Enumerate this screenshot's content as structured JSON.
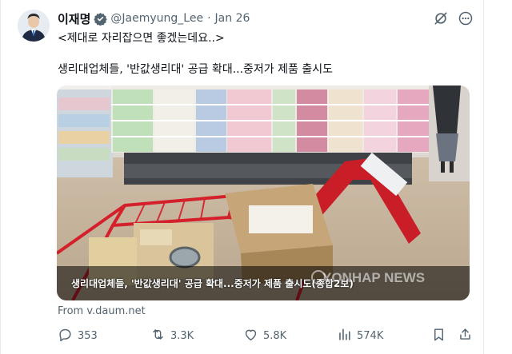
{
  "post": {
    "author_name": "이재명",
    "handle": "@Jaemyung_Lee",
    "separator": "·",
    "date": "Jan 26",
    "text_line1": "<제대로 자리잡으면 좋겠는데요..>",
    "text_line2": "생리대업체들, '반값생리대' 공급 확대...중저가 제품 출시도"
  },
  "card": {
    "caption": "생리대업체들, '반값생리대' 공급 확대...중저가 제품 출시도(종합2보)",
    "watermark": "YONHAP NEWS",
    "source": "From v.daum.net"
  },
  "actions": {
    "replies": "353",
    "reposts": "3.3K",
    "likes": "5.8K",
    "views": "574K"
  },
  "colors": {
    "text_primary": "#0f1419",
    "text_secondary": "#536471",
    "verified_blue": "#1d9bf0",
    "cart_red": "#d4202a"
  },
  "icons": {
    "verified": "verified-badge-icon",
    "grok": "grok-icon",
    "more": "more-dots-icon",
    "reply": "reply-icon",
    "repost": "repost-icon",
    "like": "like-icon",
    "views": "views-icon",
    "bookmark": "bookmark-icon",
    "share": "share-icon"
  }
}
